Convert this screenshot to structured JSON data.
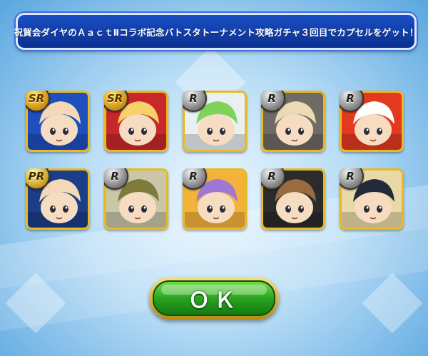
{
  "banner": {
    "title": "祝賀会ダイヤのＡａｃｔⅡコラボ記念バトスタトーナメント攻略ガチャ３回目でカプセルをゲット！"
  },
  "results": [
    {
      "rarity": "SR",
      "portrait": "batter-blue-helmet",
      "bg": "#1e4fbf",
      "accent": "#f3d9b5"
    },
    {
      "rarity": "SR",
      "portrait": "girl-blonde-red-cap",
      "bg": "#c9282b",
      "accent": "#f5d26a"
    },
    {
      "rarity": "R",
      "portrait": "boy-green-hair",
      "bg": "#e8f0f2",
      "accent": "#7fd35a"
    },
    {
      "rarity": "R",
      "portrait": "boy-blonde-hair",
      "bg": "#6f6a64",
      "accent": "#eadbb4"
    },
    {
      "rarity": "R",
      "portrait": "hero-white-helmet",
      "bg": "#e33a1f",
      "accent": "#ffffff"
    },
    {
      "rarity": "PR",
      "portrait": "batter-blue-helmet-2",
      "bg": "#1c3d88",
      "accent": "#f3d9b5"
    },
    {
      "rarity": "R",
      "portrait": "curly-hair-goggles",
      "bg": "#c9c7a8",
      "accent": "#7e7a3a"
    },
    {
      "rarity": "R",
      "portrait": "purple-hair-glasses",
      "bg": "#f3b23a",
      "accent": "#9f78d6"
    },
    {
      "rarity": "R",
      "portrait": "brown-hair-boy",
      "bg": "#2b2b2b",
      "accent": "#9a6b3e"
    },
    {
      "rarity": "R",
      "portrait": "captain-hat-girl",
      "bg": "#e9d9a8",
      "accent": "#222a3a"
    }
  ],
  "ok_button": {
    "label": "ＯＫ"
  }
}
